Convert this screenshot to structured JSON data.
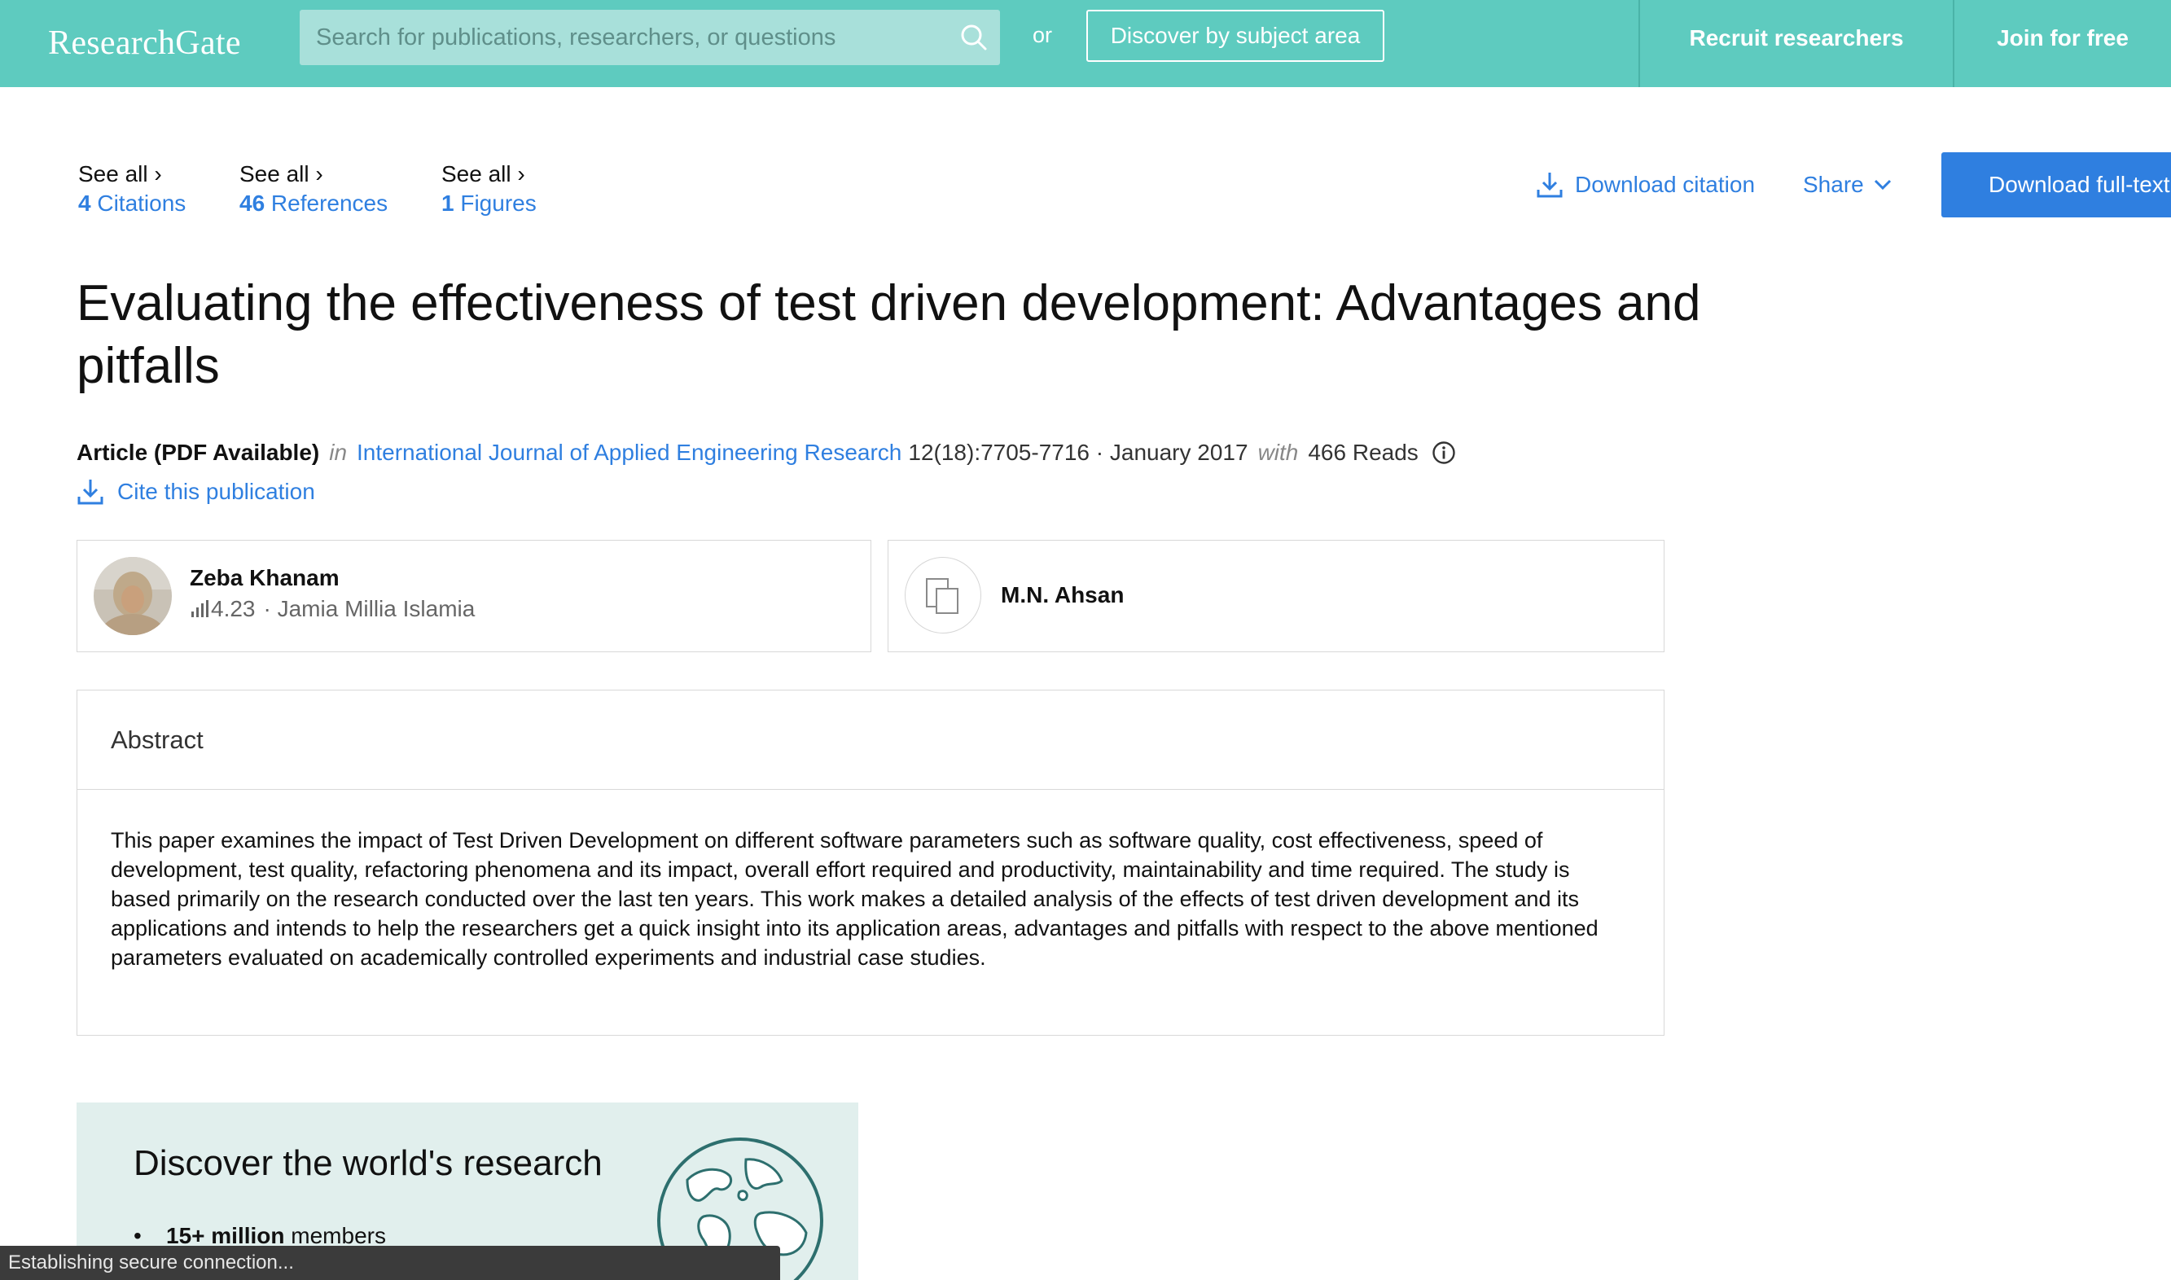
{
  "header": {
    "logo": "ResearchGate",
    "search_placeholder": "Search for publications, researchers, or questions",
    "or": "or",
    "discover_button": "Discover by subject area",
    "recruit": "Recruit researchers",
    "join": "Join for free",
    "bar_color": "#5ecbbf"
  },
  "stats": [
    {
      "see_all": "See all ›",
      "count": "4",
      "label": " Citations"
    },
    {
      "see_all": "See all ›",
      "count": "46",
      "label": " References"
    },
    {
      "see_all": "See all ›",
      "count": "1",
      "label": " Figures"
    }
  ],
  "actions": {
    "download_citation": "Download citation",
    "share": "Share",
    "download_fulltext": "Download full-text"
  },
  "publication": {
    "title": "Evaluating the effectiveness of test driven development: Advantages and pitfalls",
    "type": "Article (PDF Available)",
    "in": "in",
    "journal": "International Journal of Applied Engineering Research",
    "pages_date": "12(18):7705-7716 · January 2017",
    "with": "with",
    "reads": "466 Reads",
    "cite": "Cite this publication"
  },
  "authors": [
    {
      "name": "Zeba Khanam",
      "score": "4.23",
      "affiliation": "· Jamia Millia Islamia"
    },
    {
      "name": "M.N. Ahsan"
    }
  ],
  "abstract": {
    "heading": "Abstract",
    "text": "This paper examines the impact of Test Driven Development on different software parameters such as software quality, cost effectiveness, speed of development, test quality, refactoring phenomena and its impact, overall effort required and productivity, maintainability and time required. The study is based primarily on the research conducted over the last ten years. This work makes a detailed analysis of the effects of test driven development and its applications and intends to help the researchers get a quick insight into its application areas, advantages and pitfalls with respect to the above mentioned parameters evaluated on academically controlled experiments and industrial case studies."
  },
  "promo": {
    "title": "Discover the world's research",
    "bullet_bold": "15+ million",
    "bullet_rest": " members"
  },
  "status_bar": "Establishing secure connection...",
  "colors": {
    "accent": "#2f7fe0",
    "brand": "#5ecbbf",
    "promo_bg": "#e1efed"
  }
}
